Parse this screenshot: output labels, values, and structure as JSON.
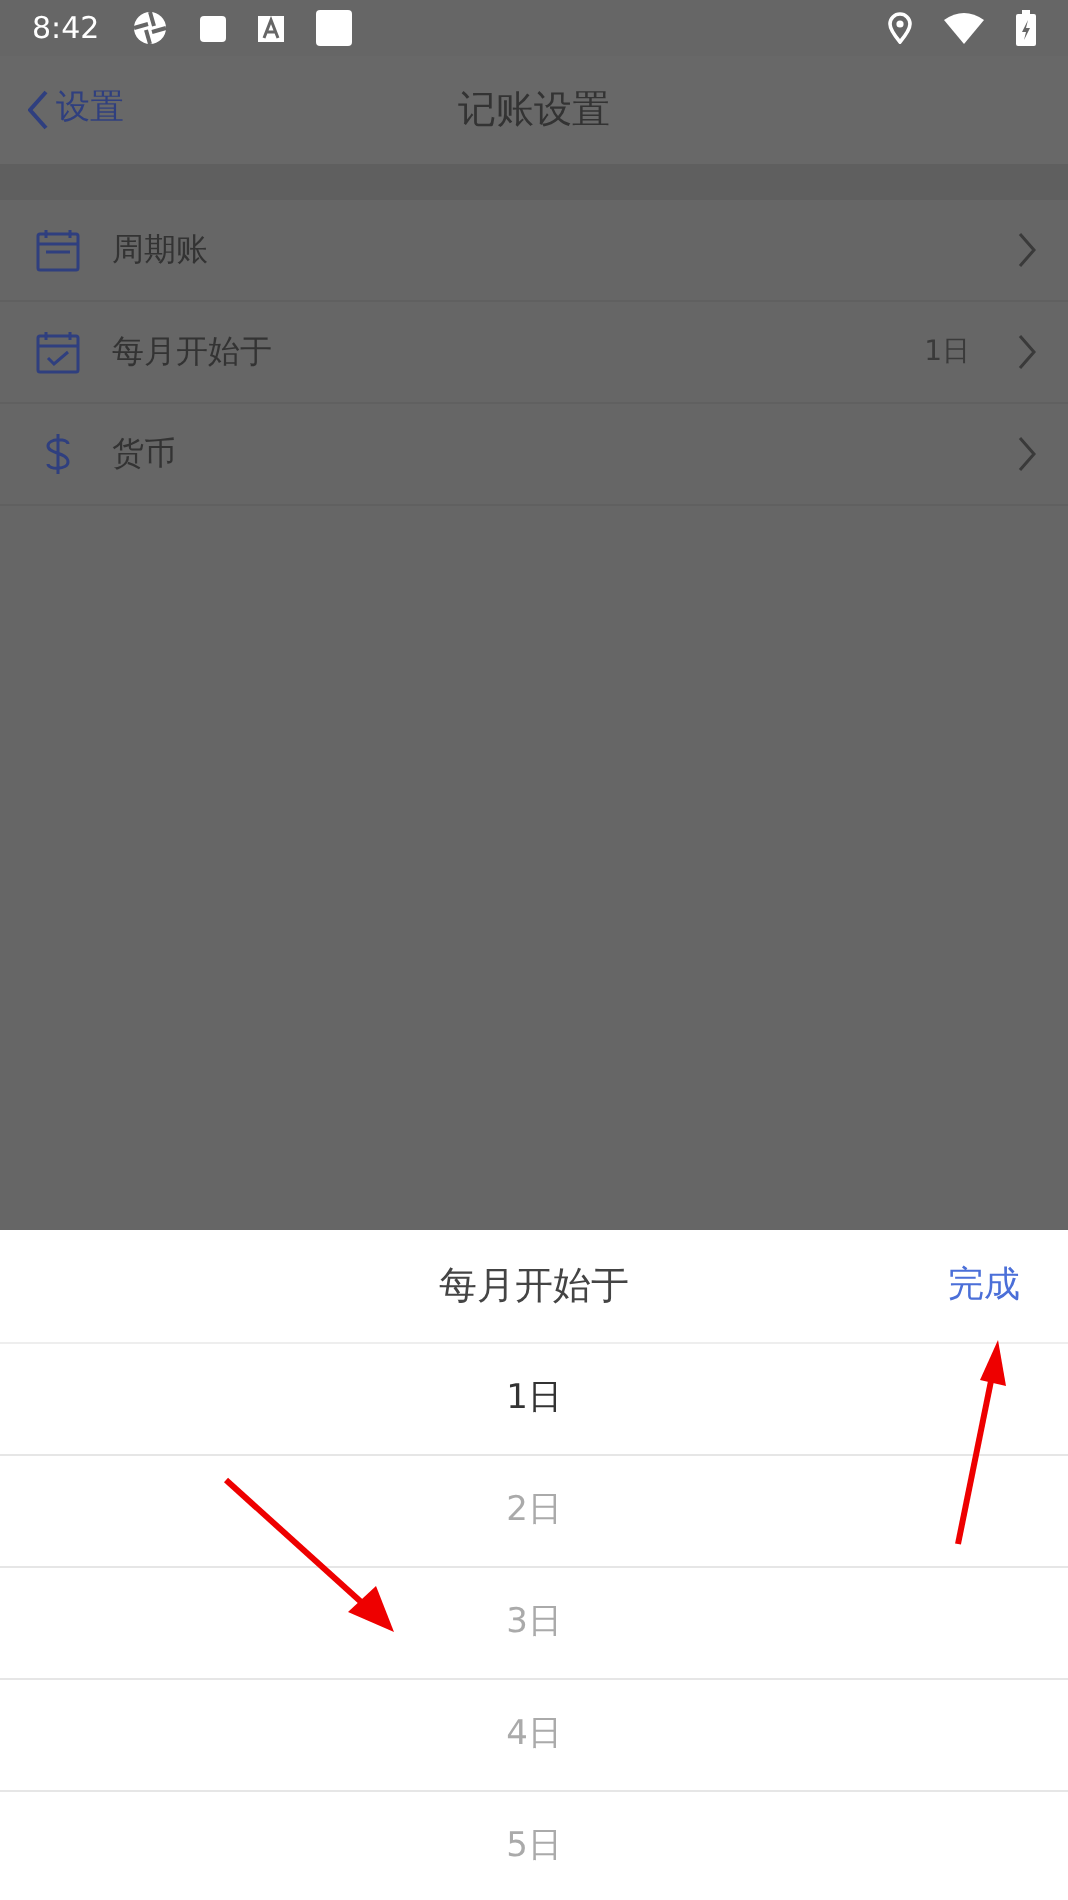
{
  "status_bar": {
    "time": "8:42"
  },
  "header": {
    "back_label": "设置",
    "title": "记账设置"
  },
  "settings": [
    {
      "kind": "calendar",
      "label": "周期账"
    },
    {
      "kind": "calendar-check",
      "label": "每月开始于",
      "value": "1日"
    },
    {
      "kind": "currency",
      "label": "货币"
    }
  ],
  "picker": {
    "title": "每月开始于",
    "done_label": "完成",
    "options": [
      {
        "label": "1日",
        "selected": true
      },
      {
        "label": "2日",
        "selected": false
      },
      {
        "label": "3日",
        "selected": false
      },
      {
        "label": "4日",
        "selected": false
      },
      {
        "label": "5日",
        "selected": false
      }
    ]
  }
}
